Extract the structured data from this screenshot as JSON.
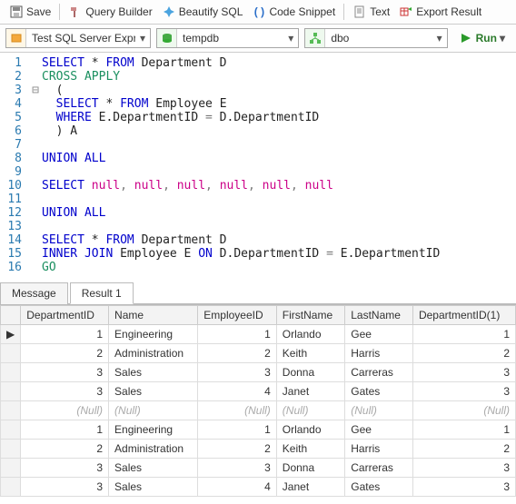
{
  "toolbar": {
    "save": "Save",
    "query_builder": "Query Builder",
    "beautify": "Beautify SQL",
    "snippet": "Code Snippet",
    "text": "Text",
    "export": "Export Result"
  },
  "connection": {
    "server": "Test SQL Server Expres",
    "database": "tempdb",
    "schema": "dbo",
    "run": "Run"
  },
  "code_lines": [
    {
      "n": 1,
      "fold": "",
      "segs": [
        [
          "kw",
          "SELECT"
        ],
        [
          "plain",
          " * "
        ],
        [
          "kw",
          "FROM"
        ],
        [
          "plain",
          " Department D"
        ]
      ]
    },
    {
      "n": 2,
      "fold": "",
      "segs": [
        [
          "ident",
          "CROSS APPLY"
        ]
      ]
    },
    {
      "n": 3,
      "fold": "⊟",
      "segs": [
        [
          "plain",
          "  ("
        ]
      ]
    },
    {
      "n": 4,
      "fold": "",
      "segs": [
        [
          "plain",
          "  "
        ],
        [
          "kw",
          "SELECT"
        ],
        [
          "plain",
          " * "
        ],
        [
          "kw",
          "FROM"
        ],
        [
          "plain",
          " Employee E"
        ]
      ]
    },
    {
      "n": 5,
      "fold": "",
      "segs": [
        [
          "plain",
          "  "
        ],
        [
          "kw",
          "WHERE"
        ],
        [
          "plain",
          " E.DepartmentID "
        ],
        [
          "grey",
          "="
        ],
        [
          "plain",
          " D.DepartmentID"
        ]
      ]
    },
    {
      "n": 6,
      "fold": "",
      "segs": [
        [
          "plain",
          "  ) A"
        ]
      ]
    },
    {
      "n": 7,
      "fold": "",
      "segs": []
    },
    {
      "n": 8,
      "fold": "",
      "segs": [
        [
          "kw",
          "UNION ALL"
        ]
      ]
    },
    {
      "n": 9,
      "fold": "",
      "segs": []
    },
    {
      "n": 10,
      "fold": "",
      "segs": [
        [
          "kw",
          "SELECT"
        ],
        [
          "plain",
          " "
        ],
        [
          "func",
          "null"
        ],
        [
          "grey",
          ", "
        ],
        [
          "func",
          "null"
        ],
        [
          "grey",
          ", "
        ],
        [
          "func",
          "null"
        ],
        [
          "grey",
          ", "
        ],
        [
          "func",
          "null"
        ],
        [
          "grey",
          ", "
        ],
        [
          "func",
          "null"
        ],
        [
          "grey",
          ", "
        ],
        [
          "func",
          "null"
        ]
      ]
    },
    {
      "n": 11,
      "fold": "",
      "segs": []
    },
    {
      "n": 12,
      "fold": "",
      "segs": [
        [
          "kw",
          "UNION ALL"
        ]
      ]
    },
    {
      "n": 13,
      "fold": "",
      "segs": []
    },
    {
      "n": 14,
      "fold": "",
      "segs": [
        [
          "kw",
          "SELECT"
        ],
        [
          "plain",
          " * "
        ],
        [
          "kw",
          "FROM"
        ],
        [
          "plain",
          " Department D"
        ]
      ]
    },
    {
      "n": 15,
      "fold": "",
      "segs": [
        [
          "kw",
          "INNER JOIN"
        ],
        [
          "plain",
          " Employee E "
        ],
        [
          "kw",
          "ON"
        ],
        [
          "plain",
          " D.DepartmentID "
        ],
        [
          "grey",
          "="
        ],
        [
          "plain",
          " E.DepartmentID"
        ]
      ]
    },
    {
      "n": 16,
      "fold": "",
      "segs": [
        [
          "ident",
          "GO"
        ]
      ]
    }
  ],
  "tabs": {
    "message": "Message",
    "result": "Result 1"
  },
  "grid": {
    "columns": [
      "DepartmentID",
      "Name",
      "EmployeeID",
      "FirstName",
      "LastName",
      "DepartmentID(1)"
    ],
    "rows": [
      {
        "mark": "▶",
        "cells": [
          "1",
          "Engineering",
          "1",
          "Orlando",
          "Gee",
          "1"
        ],
        "null": false
      },
      {
        "mark": "",
        "cells": [
          "2",
          "Administration",
          "2",
          "Keith",
          "Harris",
          "2"
        ],
        "null": false
      },
      {
        "mark": "",
        "cells": [
          "3",
          "Sales",
          "3",
          "Donna",
          "Carreras",
          "3"
        ],
        "null": false
      },
      {
        "mark": "",
        "cells": [
          "3",
          "Sales",
          "4",
          "Janet",
          "Gates",
          "3"
        ],
        "null": false
      },
      {
        "mark": "",
        "cells": [
          "(Null)",
          "(Null)",
          "(Null)",
          "(Null)",
          "(Null)",
          "(Null)"
        ],
        "null": true
      },
      {
        "mark": "",
        "cells": [
          "1",
          "Engineering",
          "1",
          "Orlando",
          "Gee",
          "1"
        ],
        "null": false
      },
      {
        "mark": "",
        "cells": [
          "2",
          "Administration",
          "2",
          "Keith",
          "Harris",
          "2"
        ],
        "null": false
      },
      {
        "mark": "",
        "cells": [
          "3",
          "Sales",
          "3",
          "Donna",
          "Carreras",
          "3"
        ],
        "null": false
      },
      {
        "mark": "",
        "cells": [
          "3",
          "Sales",
          "4",
          "Janet",
          "Gates",
          "3"
        ],
        "null": false
      }
    ]
  }
}
